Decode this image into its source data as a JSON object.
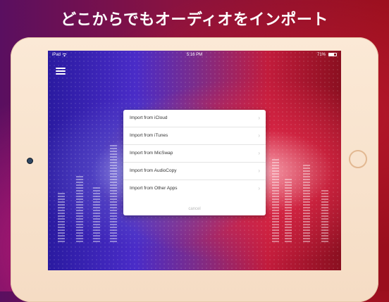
{
  "headline": "どこからでもオーディオをインポート",
  "status_bar": {
    "carrier": "iPad",
    "wifi_icon": "wifi-icon",
    "time": "5:16 PM",
    "battery": "71%",
    "battery_level": 0.71
  },
  "menu": {
    "icon": "hamburger-menu-icon"
  },
  "import_sheet": {
    "items": [
      {
        "label": "Import from iCloud"
      },
      {
        "label": "Import from iTunes"
      },
      {
        "label": "Import from MicSwap"
      },
      {
        "label": "Import from AudioCopy"
      },
      {
        "label": "Import from Other Apps"
      }
    ],
    "cancel": "cancel",
    "chevron_icon": "chevron-right-icon"
  },
  "colors": {
    "background_left": "#5a0f60",
    "background_right": "#9a0f1c",
    "device_frame": "#fbe9d6",
    "sheet": "#ffffff"
  }
}
